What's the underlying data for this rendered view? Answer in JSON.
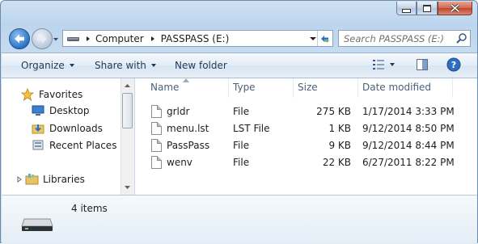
{
  "window": {
    "caption_buttons": [
      "minimize-icon",
      "maximize-icon",
      "close-icon"
    ]
  },
  "address": {
    "root_icon": "computer-drive-icon",
    "crumbs": [
      "Computer",
      "PASSPASS (E:)"
    ],
    "refresh_icon": "refresh-icon"
  },
  "search": {
    "placeholder": "Search PASSPASS (E:)"
  },
  "toolbar": {
    "organize": "Organize",
    "share_with": "Share with",
    "new_folder": "New folder",
    "views_icon": "views-icon",
    "help_icon": "help-icon"
  },
  "nav": {
    "favorites": "Favorites",
    "desktop": "Desktop",
    "downloads": "Downloads",
    "recent_places": "Recent Places",
    "libraries": "Libraries"
  },
  "columns": {
    "name": "Name",
    "type": "Type",
    "size": "Size",
    "date_modified": "Date modified"
  },
  "files": [
    {
      "name": "grldr",
      "type": "File",
      "size": "275 KB",
      "date": "1/17/2014 3:33 PM"
    },
    {
      "name": "menu.lst",
      "type": "LST File",
      "size": "1 KB",
      "date": "9/12/2014 8:50 PM"
    },
    {
      "name": "PassPass",
      "type": "File",
      "size": "9 KB",
      "date": "9/12/2014 8:44 PM"
    },
    {
      "name": "wenv",
      "type": "File",
      "size": "22 KB",
      "date": "6/27/2011 8:22 PM"
    }
  ],
  "details": {
    "count": "4 items",
    "icon": "removable-drive-icon"
  },
  "colors": {
    "frame": "#c5dbf0",
    "toolbar_text": "#1e395b",
    "close_button": "#c2442a"
  }
}
